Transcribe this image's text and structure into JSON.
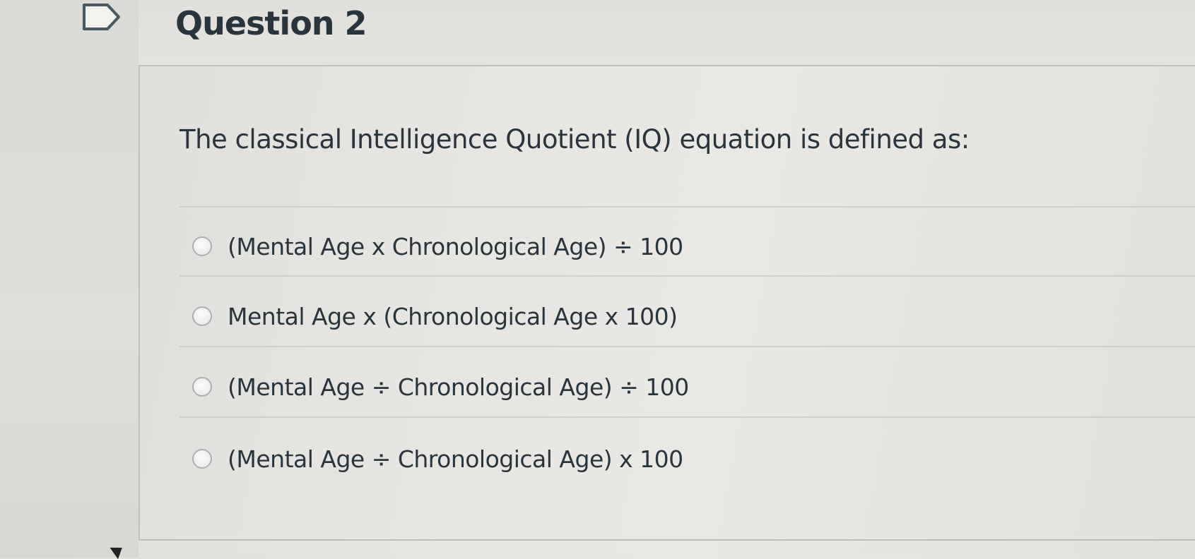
{
  "question": {
    "title": "Question 2",
    "prompt": "The classical Intelligence Quotient (IQ) equation is defined as:",
    "answers": [
      {
        "label": "(Mental Age x Chronological Age) ÷ 100"
      },
      {
        "label": "Mental Age x (Chronological Age x 100)"
      },
      {
        "label": "(Mental Age ÷ Chronological Age) ÷ 100"
      },
      {
        "label": "(Mental Age ÷ Chronological Age) x 100"
      }
    ]
  },
  "icons": {
    "flag": "flag-icon",
    "radio": "radio-button-icon"
  }
}
